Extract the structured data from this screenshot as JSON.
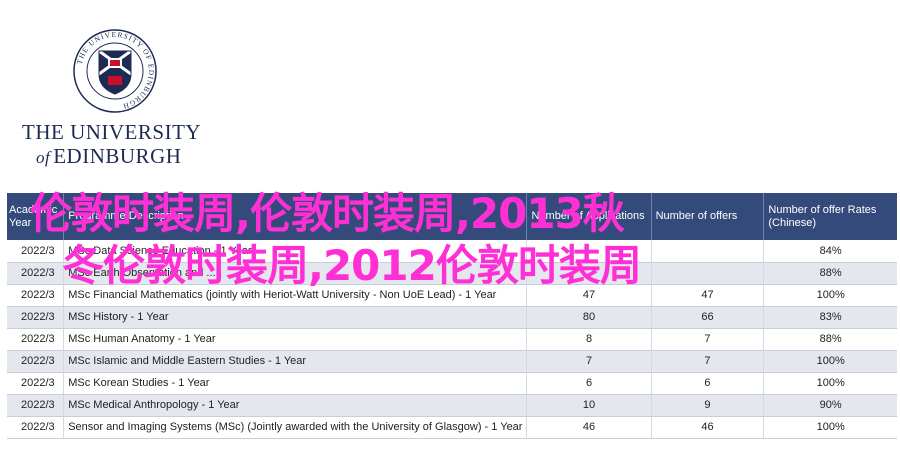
{
  "logo": {
    "ring_text": "THE UNIVERSITY OF EDINBURGH",
    "line1": "THE UNIVERSITY",
    "line2_of": "of",
    "line2_name": "EDINBURGH",
    "colors": {
      "navy": "#1d2b52",
      "red": "#c8102e"
    }
  },
  "table": {
    "headers": {
      "year": "Academic Year",
      "programme": "Programme Description",
      "applications": "Number of Applications",
      "offers": "Number of offers",
      "rate": "Number of offer Rates (Chinese)"
    },
    "rows": [
      {
        "year": "2022/3",
        "programme": "MSc Data Science Education - 1 Year",
        "applications": "",
        "offers": "",
        "rate": "84%"
      },
      {
        "year": "2022/3",
        "programme": "MSc Earth Observation and ...",
        "applications": "",
        "offers": "",
        "rate": "88%"
      },
      {
        "year": "2022/3",
        "programme": "MSc Financial Mathematics (jointly with Heriot-Watt University - Non UoE Lead) - 1 Year",
        "applications": "47",
        "offers": "47",
        "rate": "100%"
      },
      {
        "year": "2022/3",
        "programme": "MSc History - 1 Year",
        "applications": "80",
        "offers": "66",
        "rate": "83%"
      },
      {
        "year": "2022/3",
        "programme": "MSc Human Anatomy - 1 Year",
        "applications": "8",
        "offers": "7",
        "rate": "88%"
      },
      {
        "year": "2022/3",
        "programme": "MSc Islamic and Middle Eastern Studies - 1 Year",
        "applications": "7",
        "offers": "7",
        "rate": "100%"
      },
      {
        "year": "2022/3",
        "programme": "MSc Korean Studies - 1 Year",
        "applications": "6",
        "offers": "6",
        "rate": "100%"
      },
      {
        "year": "2022/3",
        "programme": "MSc Medical Anthropology - 1 Year",
        "applications": "10",
        "offers": "9",
        "rate": "90%"
      },
      {
        "year": "2022/3",
        "programme": "Sensor and Imaging Systems (MSc) (Jointly awarded with the University of Glasgow) - 1 Year",
        "applications": "46",
        "offers": "46",
        "rate": "100%"
      }
    ]
  },
  "overlay": {
    "line1": "伦敦时装周,伦敦时装周,2013秋",
    "line2": "冬伦敦时装周,2012伦敦时装周",
    "color": "#ff2fd6"
  },
  "colors": {
    "header_bg": "#344a7a",
    "row_alt": "#e4e7ee"
  }
}
